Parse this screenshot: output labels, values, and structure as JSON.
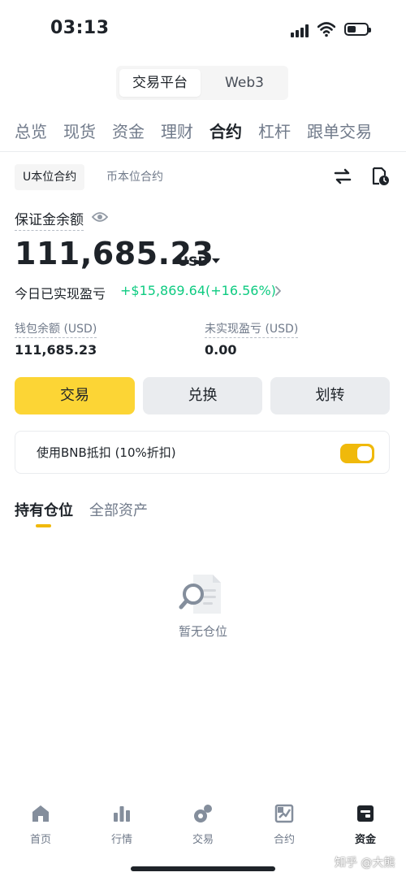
{
  "status_bar": {
    "time": "03:13"
  },
  "platform_toggle": {
    "active": "交易平台",
    "inactive": "Web3"
  },
  "top_tabs": [
    {
      "label": "总览"
    },
    {
      "label": "现货"
    },
    {
      "label": "资金"
    },
    {
      "label": "理财"
    },
    {
      "label": "合约"
    },
    {
      "label": "杠杆"
    },
    {
      "label": "跟单交易"
    }
  ],
  "sub_tabs": {
    "active": "U本位合约",
    "inactive": "币本位合约"
  },
  "balance": {
    "label": "保证金余额",
    "value": "111,685.23",
    "currency": "USD",
    "pnl_label": "今日已实现盈亏",
    "pnl_value": "+$15,869.64(+16.56%)",
    "wallet_label": "钱包余额 (USD)",
    "wallet_value": "111,685.23",
    "unrealized_label": "未实现盈亏 (USD)",
    "unrealized_value": "0.00"
  },
  "actions": {
    "trade": "交易",
    "convert": "兑换",
    "transfer": "划转"
  },
  "bnb_discount": {
    "label": "使用BNB抵扣 (10%折扣)",
    "enabled": true
  },
  "position_tabs": {
    "active": "持有仓位",
    "inactive": "全部资产"
  },
  "empty_state": {
    "text": "暂无仓位"
  },
  "bottom_nav": [
    {
      "label": "首页",
      "icon": "home-icon"
    },
    {
      "label": "行情",
      "icon": "chart-bar-icon"
    },
    {
      "label": "交易",
      "icon": "trade-icon"
    },
    {
      "label": "合约",
      "icon": "futures-icon"
    },
    {
      "label": "资金",
      "icon": "wallet-icon"
    }
  ],
  "watermark": "知乎 @大熊",
  "colors": {
    "accent": "#fcd535",
    "toggle": "#f0b90b",
    "profit": "#0ecb81",
    "text": "#1e2329",
    "muted": "#707a8a"
  }
}
